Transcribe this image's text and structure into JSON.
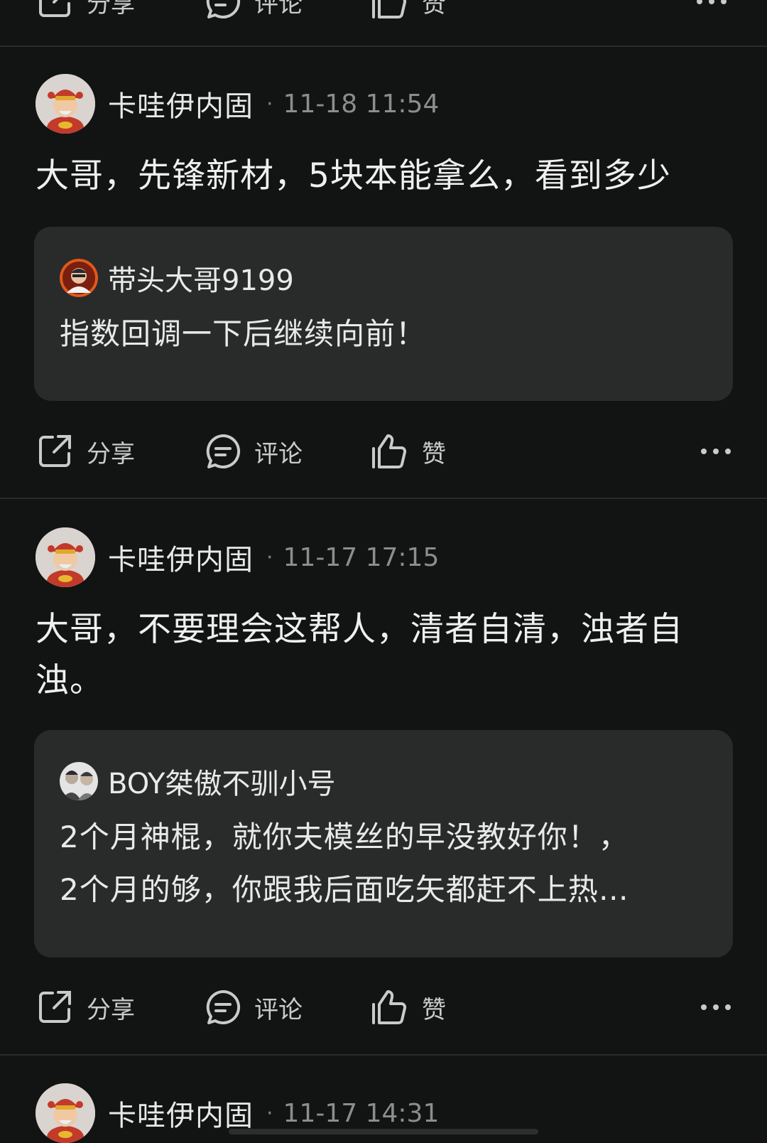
{
  "actions": {
    "share": "分享",
    "comment": "评论",
    "like": "赞"
  },
  "posts": [
    {
      "author": "卡哇伊内固",
      "time": "11-18 11:54",
      "text": "大哥，先锋新材，5块本能拿么，看到多少",
      "quote": {
        "name": "带头大哥9199",
        "lines": [
          "指数回调一下后继续向前！"
        ]
      }
    },
    {
      "author": "卡哇伊内固",
      "time": "11-17 17:15",
      "text": "大哥，不要理会这帮人，清者自清，浊者自浊。",
      "quote": {
        "name": "BOY桀傲不驯小号",
        "lines": [
          "2个月神棍，就你夫模丝的早没教好你！，",
          "2个月的够，你跟我后面吃矢都赶不上热…"
        ]
      }
    },
    {
      "author": "卡哇伊内固",
      "time": "11-17 14:31"
    }
  ]
}
